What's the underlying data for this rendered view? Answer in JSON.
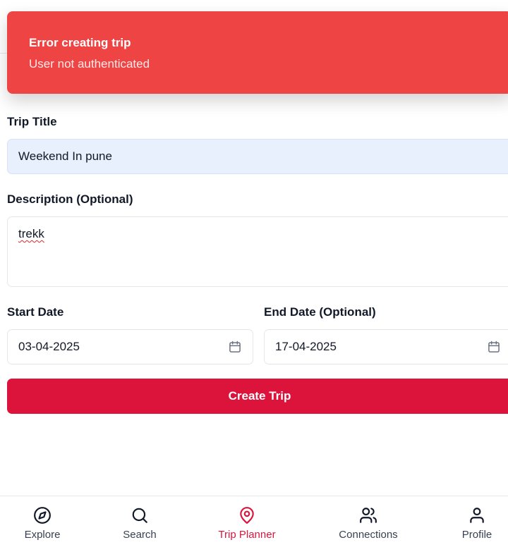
{
  "toast": {
    "title": "Error creating trip",
    "message": "User not authenticated"
  },
  "form": {
    "title_label": "Trip Title",
    "title_value": "Weekend In pune",
    "description_label": "Description (Optional)",
    "description_value": "trekk",
    "start_date_label": "Start Date",
    "start_date_value": "03-04-2025",
    "end_date_label": "End Date (Optional)",
    "end_date_value": "17-04-2025",
    "submit_label": "Create Trip"
  },
  "nav": {
    "items": [
      {
        "label": "Explore",
        "icon": "compass-icon"
      },
      {
        "label": "Search",
        "icon": "search-icon"
      },
      {
        "label": "Trip Planner",
        "icon": "map-pin-icon",
        "active": true
      },
      {
        "label": "Connections",
        "icon": "users-icon"
      },
      {
        "label": "Profile",
        "icon": "user-icon"
      }
    ]
  },
  "colors": {
    "toast_bg": "#ef4444",
    "accent": "#dc143c",
    "filled_input_bg": "#e8f0fe"
  }
}
